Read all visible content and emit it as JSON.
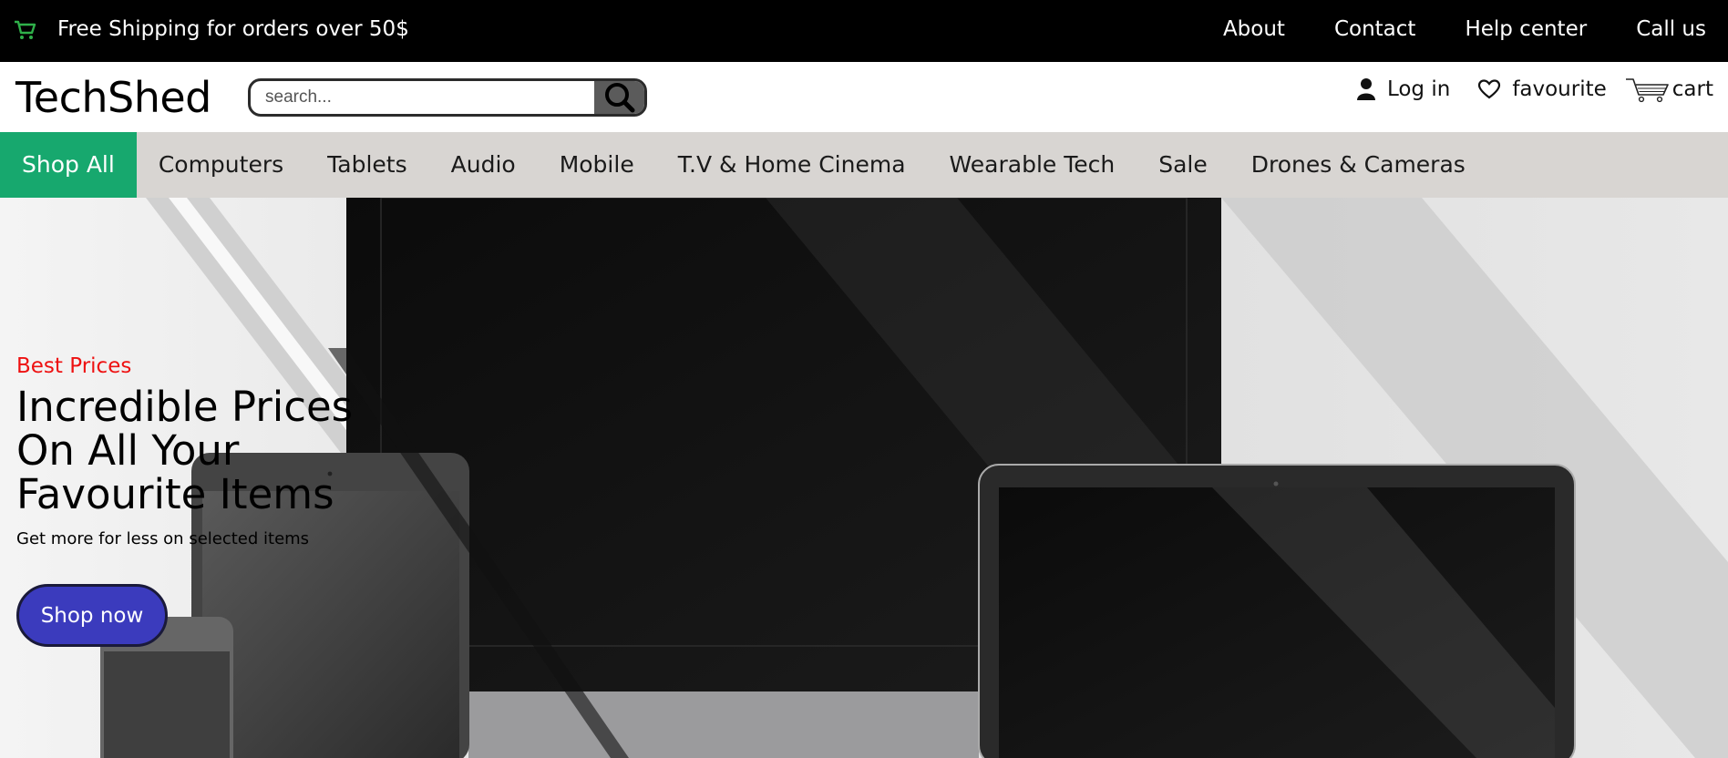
{
  "topbar": {
    "promo": "Free Shipping for orders over 50$",
    "links": [
      "About",
      "Contact",
      "Help center",
      "Call us"
    ]
  },
  "header": {
    "logo": "TechShed",
    "search": {
      "placeholder": "search...",
      "value": ""
    },
    "login": "Log in",
    "favourite": "favourite",
    "cart": "cart"
  },
  "nav": {
    "categories": [
      "Shop All",
      "Computers",
      "Tablets",
      "Audio",
      "Mobile",
      "T.V & Home Cinema",
      "Wearable Tech",
      "Sale",
      "Drones & Cameras"
    ],
    "active": "Shop All"
  },
  "hero": {
    "eyebrow": "Best Prices",
    "headline": "Incredible Prices On All Your Favourite Items",
    "subtext": "Get more for less on selected items",
    "cta": "Shop now"
  },
  "colors": {
    "topbar_bg": "#000000",
    "cart_icon": "#2fb04a",
    "nav_bg": "#d8d5d2",
    "nav_active": "#17a86e",
    "eyebrow": "#ee1111",
    "cta_bg": "#3b3bbd"
  },
  "icons": [
    "shopping-cart-icon",
    "search-icon",
    "user-icon",
    "heart-icon",
    "cart-icon"
  ]
}
